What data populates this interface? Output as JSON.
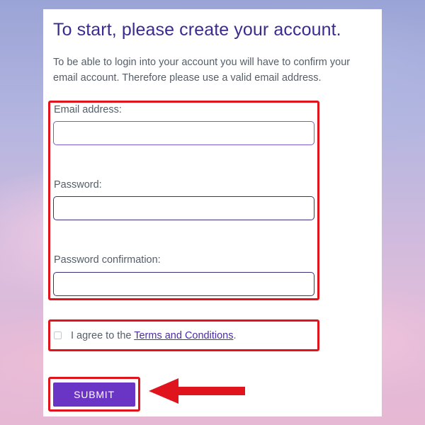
{
  "form": {
    "title": "To start, please create your account.",
    "intro_line1": "To be able to login into your account you will have to confirm your",
    "intro_line2": "email account. Therefore please use a valid email address.",
    "email_label": "Email address:",
    "email_value": "",
    "password_label": "Password:",
    "password_value": "",
    "password_confirmation_label": "Password confirmation:",
    "password_confirmation_value": "",
    "agree_prefix": "I agree to the ",
    "terms_link": "Terms and Conditions",
    "agree_suffix": ".",
    "terms_checked": false,
    "submit_label": "SUBMIT"
  },
  "annotations": {
    "highlight_color": "#e0141d",
    "arrow_color": "#e0141d",
    "arrow_icon": "arrow-left-icon"
  },
  "colors": {
    "title": "#3a2c8f",
    "button": "#6a35c4",
    "input_border": "#7d5ad0"
  }
}
